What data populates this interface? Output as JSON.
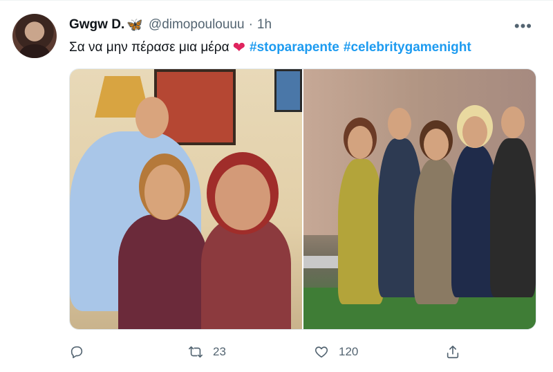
{
  "tweet": {
    "author_name": "Gwgw D.",
    "author_badge_icon": "butterfly-icon",
    "handle": "@dimopoulouuu",
    "separator": "·",
    "time": "1h",
    "more_icon": "more-icon",
    "text_before": "Σα να μην πέρασε μια μέρα",
    "heart_icon": "heart-emoji",
    "hashtags": [
      "#stoparapente",
      "#celebritygamenight"
    ],
    "media": [
      {
        "name": "photo-left"
      },
      {
        "name": "photo-right"
      }
    ]
  },
  "actions": {
    "reply_icon": "reply-icon",
    "retweet_icon": "retweet-icon",
    "retweet_count": "23",
    "like_icon": "like-icon",
    "like_count": "120",
    "share_icon": "share-icon"
  },
  "colors": {
    "link": "#1d9bf0",
    "secondary_text": "#536471",
    "heart": "#e0245e"
  }
}
